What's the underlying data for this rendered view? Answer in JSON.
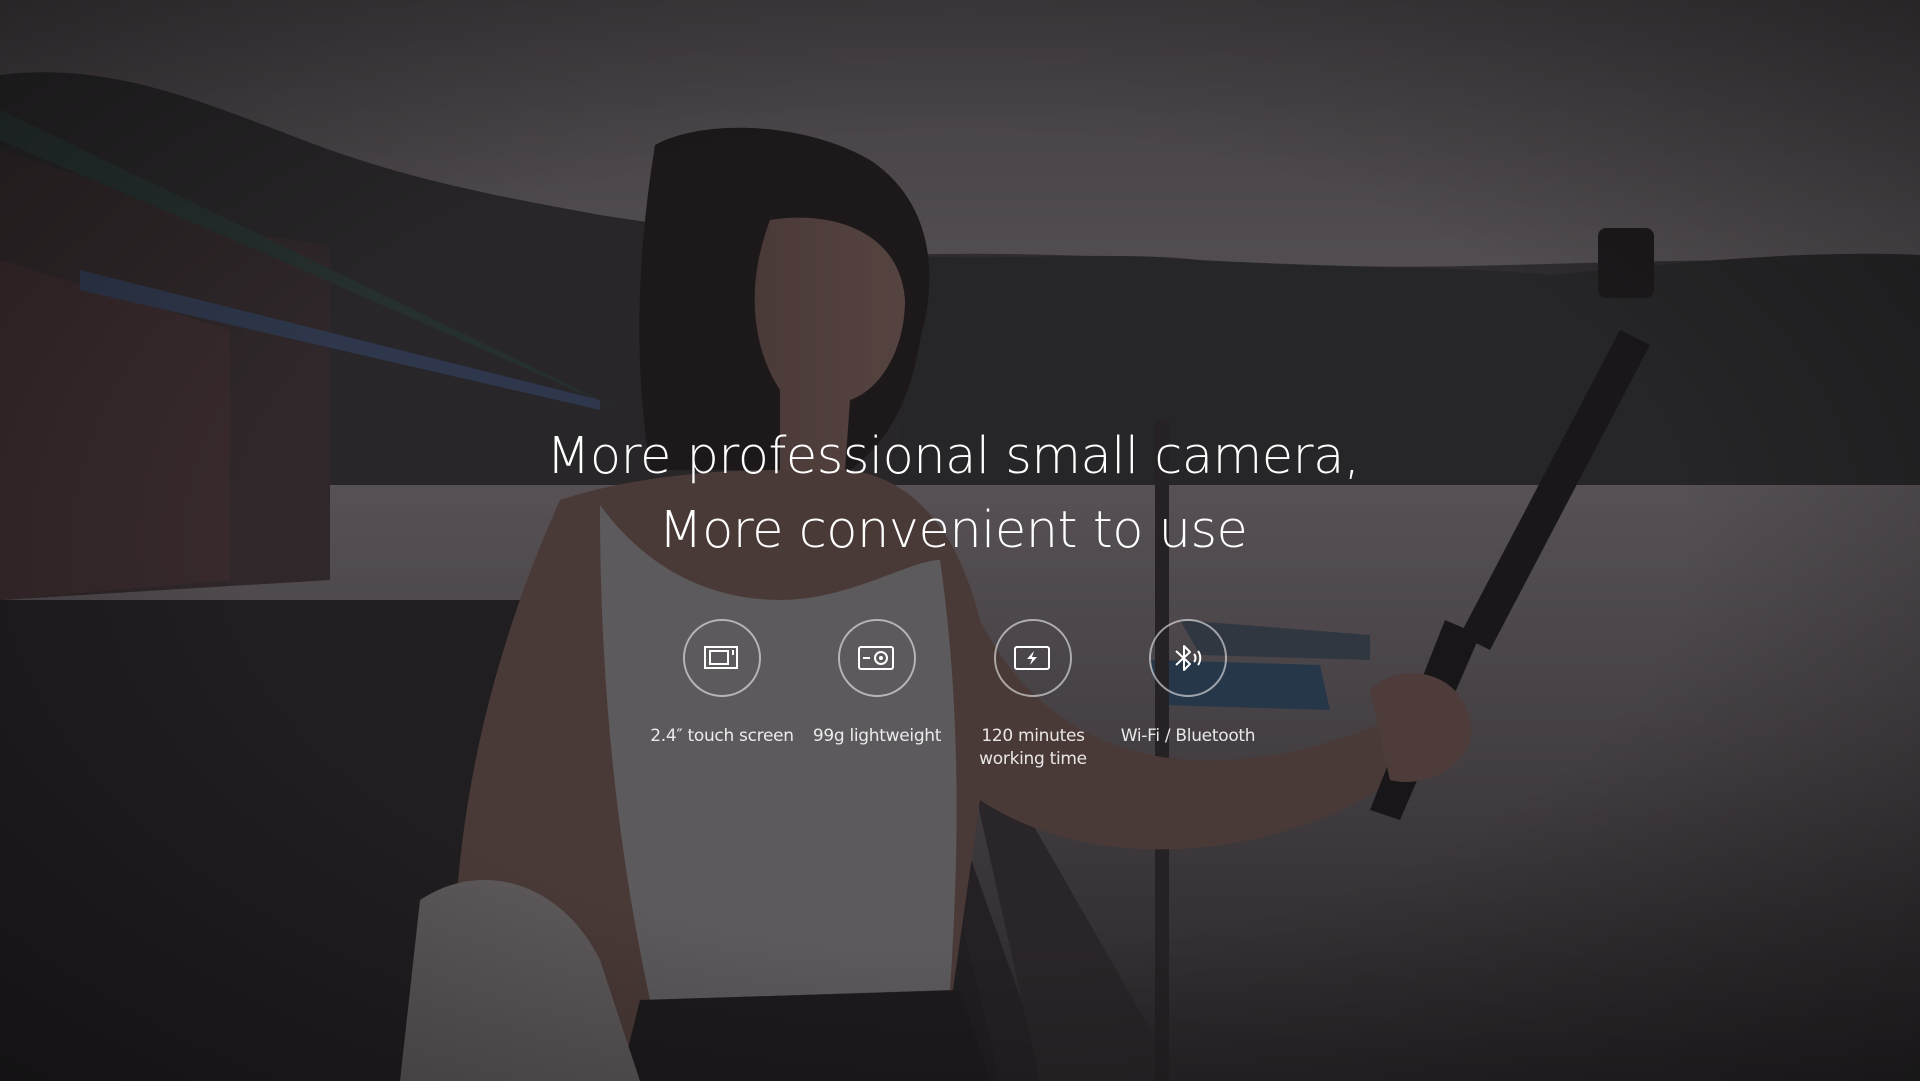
{
  "hero": {
    "line1": "More professional small camera,",
    "line2": "More convenient to use"
  },
  "features": [
    {
      "icon": "touch-screen-icon",
      "label": "2.4″  touch screen"
    },
    {
      "icon": "camera-weight-icon",
      "label": "99g lightweight"
    },
    {
      "icon": "battery-icon",
      "label1": "120 minutes",
      "label2": "working time"
    },
    {
      "icon": "bluetooth-icon",
      "label": "Wi-Fi / Bluetooth"
    }
  ],
  "colors": {
    "overlay": "#2e2e33",
    "sky": "#8c8487",
    "water": "#8f8588",
    "text": "#ffffff"
  }
}
